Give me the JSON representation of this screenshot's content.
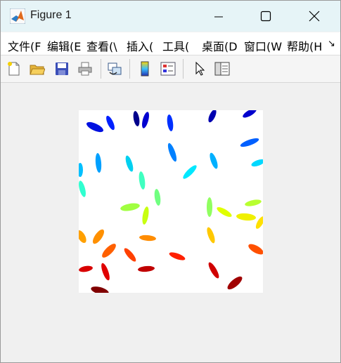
{
  "window": {
    "title": "Figure 1",
    "controls": [
      "minimize",
      "maximize",
      "close"
    ]
  },
  "menu": {
    "items": [
      "文件(F",
      "编辑(E",
      "查看(\\",
      "插入(",
      "工具(",
      "桌面(D",
      "窗口(W",
      "帮助(H"
    ],
    "overflow_glyph": "↘"
  },
  "toolbar": {
    "buttons": [
      {
        "icon": "new-figure-icon"
      },
      {
        "icon": "open-file-icon"
      },
      {
        "icon": "save-icon"
      },
      {
        "icon": "print-icon"
      },
      {
        "icon": "link-plot-icon"
      },
      {
        "icon": "insert-colorbar-icon"
      },
      {
        "icon": "insert-legend-icon"
      },
      {
        "icon": "edit-plot-arrow-icon"
      },
      {
        "icon": "property-inspector-icon"
      }
    ]
  },
  "image": {
    "description_colors": {
      "blue": "#0000cd",
      "cyan": "#00e5ff",
      "green": "#7fff5f",
      "yellow": "#e8ff00",
      "orange": "#ff8c00",
      "red": "#dd0000",
      "dark_red": "#8b0000"
    }
  }
}
